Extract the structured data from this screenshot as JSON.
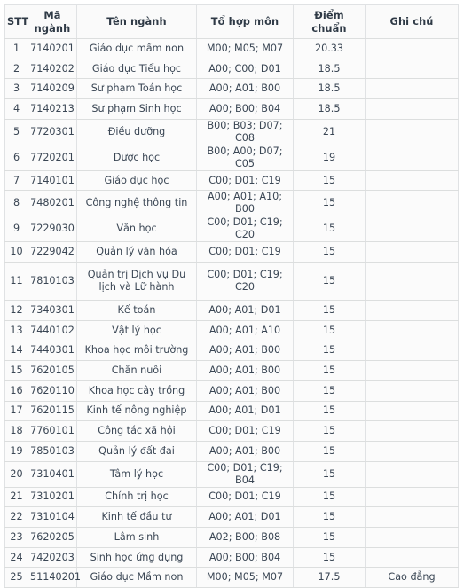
{
  "table": {
    "name": "diem-chuan-table",
    "columns": [
      {
        "key": "stt",
        "label": "STT"
      },
      {
        "key": "ma",
        "label_line1": "Mã",
        "label_line2": "ngành",
        "label": "Mã ngành"
      },
      {
        "key": "ten",
        "label": "Tên ngành"
      },
      {
        "key": "to",
        "label": "Tổ hợp môn"
      },
      {
        "key": "diem",
        "label": "Điểm chuẩn"
      },
      {
        "key": "ghi",
        "label": "Ghi chú"
      }
    ],
    "rows": [
      {
        "stt": "1",
        "ma": "7140201",
        "ten": "Giáo dục mầm non",
        "to": "M00; M05; M07",
        "diem": "20.33",
        "ghi": ""
      },
      {
        "stt": "2",
        "ma": "7140202",
        "ten": "Giáo dục Tiểu học",
        "to": "A00; C00; D01",
        "diem": "18.5",
        "ghi": ""
      },
      {
        "stt": "3",
        "ma": "7140209",
        "ten": "Sư phạm Toán học",
        "to": "A00; A01; B00",
        "diem": "18.5",
        "ghi": ""
      },
      {
        "stt": "4",
        "ma": "7140213",
        "ten": "Sư phạm Sinh học",
        "to": "A00; B00; B04",
        "diem": "18.5",
        "ghi": ""
      },
      {
        "stt": "5",
        "ma": "7720301",
        "ten": "Điều dưỡng",
        "to": "B00; B03; D07; C08",
        "diem": "21",
        "ghi": ""
      },
      {
        "stt": "6",
        "ma": "7720201",
        "ten": "Dược học",
        "to": "B00; A00; D07; C05",
        "diem": "19",
        "ghi": ""
      },
      {
        "stt": "7",
        "ma": "7140101",
        "ten": "Giáo dục học",
        "to": "C00; D01; C19",
        "diem": "15",
        "ghi": ""
      },
      {
        "stt": "8",
        "ma": "7480201",
        "ten": "Công nghệ thông tin",
        "to": "A00; A01; A10; B00",
        "diem": "15",
        "ghi": ""
      },
      {
        "stt": "9",
        "ma": "7229030",
        "ten": "Văn học",
        "to": "C00; D01; C19; C20",
        "diem": "15",
        "ghi": ""
      },
      {
        "stt": "10",
        "ma": "7229042",
        "ten": "Quản lý văn hóa",
        "to": "C00; D01; C19",
        "diem": "15",
        "ghi": ""
      },
      {
        "stt": "11",
        "ma": "7810103",
        "ten": "Quản trị Dịch vụ Du lịch và Lữ hành",
        "to": "C00; D01; C19; C20",
        "diem": "15",
        "ghi": "",
        "tall": true
      },
      {
        "stt": "12",
        "ma": "7340301",
        "ten": "Kế toán",
        "to": "A00; A01; D01",
        "diem": "15",
        "ghi": ""
      },
      {
        "stt": "13",
        "ma": "7440102",
        "ten": "Vật lý học",
        "to": "A00; A01; A10",
        "diem": "15",
        "ghi": ""
      },
      {
        "stt": "14",
        "ma": "7440301",
        "ten": "Khoa học môi trường",
        "to": "A00; A01; B00",
        "diem": "15",
        "ghi": ""
      },
      {
        "stt": "15",
        "ma": "7620105",
        "ten": "Chăn nuôi",
        "to": "A00; A01; B00",
        "diem": "15",
        "ghi": ""
      },
      {
        "stt": "16",
        "ma": "7620110",
        "ten": "Khoa học cây trồng",
        "to": "A00; A01; B00",
        "diem": "15",
        "ghi": ""
      },
      {
        "stt": "17",
        "ma": "7620115",
        "ten": "Kinh tế nông nghiệp",
        "to": "A00; A01; D01",
        "diem": "15",
        "ghi": ""
      },
      {
        "stt": "18",
        "ma": "7760101",
        "ten": "Công tác xã hội",
        "to": "C00; D01; C19",
        "diem": "15",
        "ghi": ""
      },
      {
        "stt": "19",
        "ma": "7850103",
        "ten": "Quản lý đất đai",
        "to": "A00; A01; B00",
        "diem": "15",
        "ghi": ""
      },
      {
        "stt": "20",
        "ma": "7310401",
        "ten": "Tâm lý học",
        "to": "C00; D01; C19; B04",
        "diem": "15",
        "ghi": ""
      },
      {
        "stt": "21",
        "ma": "7310201",
        "ten": "Chính trị học",
        "to": "C00; D01; C19",
        "diem": "15",
        "ghi": ""
      },
      {
        "stt": "22",
        "ma": "7310104",
        "ten": "Kinh tế đầu tư",
        "to": "A00; A01; D01",
        "diem": "15",
        "ghi": ""
      },
      {
        "stt": "23",
        "ma": "7620205",
        "ten": "Lâm sinh",
        "to": "A02; B00; B08",
        "diem": "15",
        "ghi": ""
      },
      {
        "stt": "24",
        "ma": "7420203",
        "ten": "Sinh học ứng dụng",
        "to": "A00; B00; B04",
        "diem": "15",
        "ghi": ""
      },
      {
        "stt": "25",
        "ma": "51140201",
        "ten": "Giáo dục Mầm non",
        "to": "M00; M05; M07",
        "diem": "17.5",
        "ghi": "Cao đẳng"
      }
    ]
  },
  "colors": {
    "text": "#3a4654",
    "header_text": "#2f3a46",
    "border": "#e0e2e4",
    "row_bg": "#fbfbfb",
    "header_bg": "#fafafa"
  }
}
